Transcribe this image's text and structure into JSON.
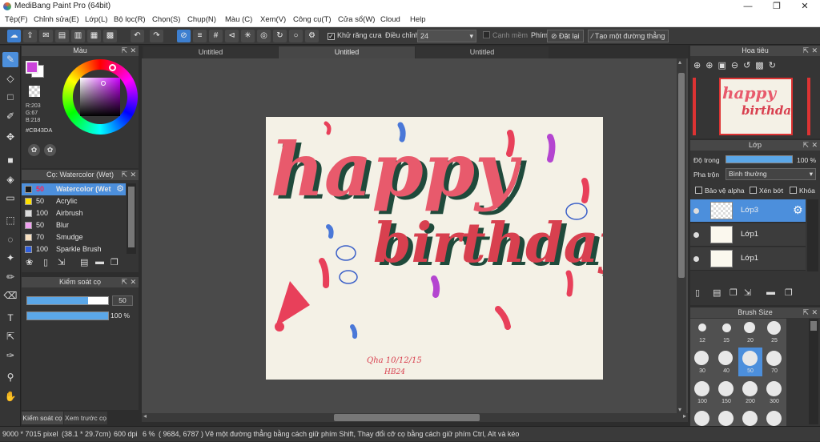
{
  "window": {
    "title": "MediBang Paint Pro (64bit)",
    "minimize": "—",
    "maximize": "❐",
    "close": "✕"
  },
  "menu": [
    "Tệp(F)",
    "Chỉnh sửa(E)",
    "Lớp(L)",
    "Bộ lọc(R)",
    "Chọn(S)",
    "Chụp(N)",
    "Màu (C)",
    "Xem(V)",
    "Công cụ(T)",
    "Cửa sổ(W)",
    "Cloud",
    "Help"
  ],
  "toolbar": {
    "antialias_label": "Khử răng cưa",
    "adjust_label": "Điều chỉnh",
    "adjust_value": "24",
    "edge_label": "Cạnh mềm",
    "key_label": "Phím",
    "reset_label": "Đặt lại",
    "line_label": "Tạo một đường thẳng"
  },
  "tabs": [
    "Untitled",
    "Untitled",
    "Untitled"
  ],
  "color_panel": {
    "title": "Màu",
    "r": "R:203",
    "g": "G:67",
    "b": "B:218",
    "hex": "#CB43DA",
    "primary_color": "#cb43da",
    "secondary_color": "#ffffff"
  },
  "brush_panel": {
    "title": "Cọ: Watercolor (Wet)",
    "items": [
      {
        "size": "50",
        "name": "Watercolor (Wet",
        "color": "#1a1a1a"
      },
      {
        "size": "50",
        "name": "Acrylic",
        "color": "#ffe000"
      },
      {
        "size": "100",
        "name": "Airbrush",
        "color": "#dcdcdc"
      },
      {
        "size": "50",
        "name": "Blur",
        "color": "#f0a0f0"
      },
      {
        "size": "70",
        "name": "Smudge",
        "color": "#f8e0c0"
      },
      {
        "size": "100",
        "name": "Sparkle Brush",
        "color": "#3060e0"
      }
    ]
  },
  "brush_control": {
    "title": "Kiểm soát cọ",
    "size_value": "50",
    "opacity_value": "100 %",
    "size_fraction": 0.75,
    "opacity_fraction": 1.0
  },
  "bottom_tabs": [
    "Kiểm soát cọ",
    "Xem trước cọ"
  ],
  "navigator": {
    "title": "Hoa tiêu"
  },
  "layer_panel": {
    "title": "Lớp",
    "opacity_label": "Độ trong",
    "opacity_value": "100 %",
    "blend_label": "Pha trộn",
    "blend_value": "Bình thường",
    "protect_alpha": "Bảo vệ alpha",
    "clip": "Xén bớt",
    "lock": "Khóa",
    "layers": [
      "Lớp3",
      "Lớp1",
      "Lớp1"
    ]
  },
  "brush_size_panel": {
    "title": "Brush Size",
    "sizes": [
      "12",
      "15",
      "20",
      "25",
      "30",
      "40",
      "50",
      "70",
      "100",
      "150",
      "200",
      "300"
    ],
    "selected": "50"
  },
  "canvas_art": {
    "word1": "happy",
    "word2": "birthday",
    "signature_line1": "Qha 10/12/15",
    "signature_line2": "HB24"
  },
  "status": {
    "size": "9000 * 7015 pixel",
    "cm": "(38.1 * 29.7cm)",
    "dpi": "600 dpi",
    "zoom": "6 %",
    "coords": "( 9684, 6787 )",
    "hint": "Vẽ một đường thẳng bằng cách giữ phím Shift, Thay đổi cỡ cọ bằng cách giữ phím Ctrl, Alt và kéo"
  }
}
